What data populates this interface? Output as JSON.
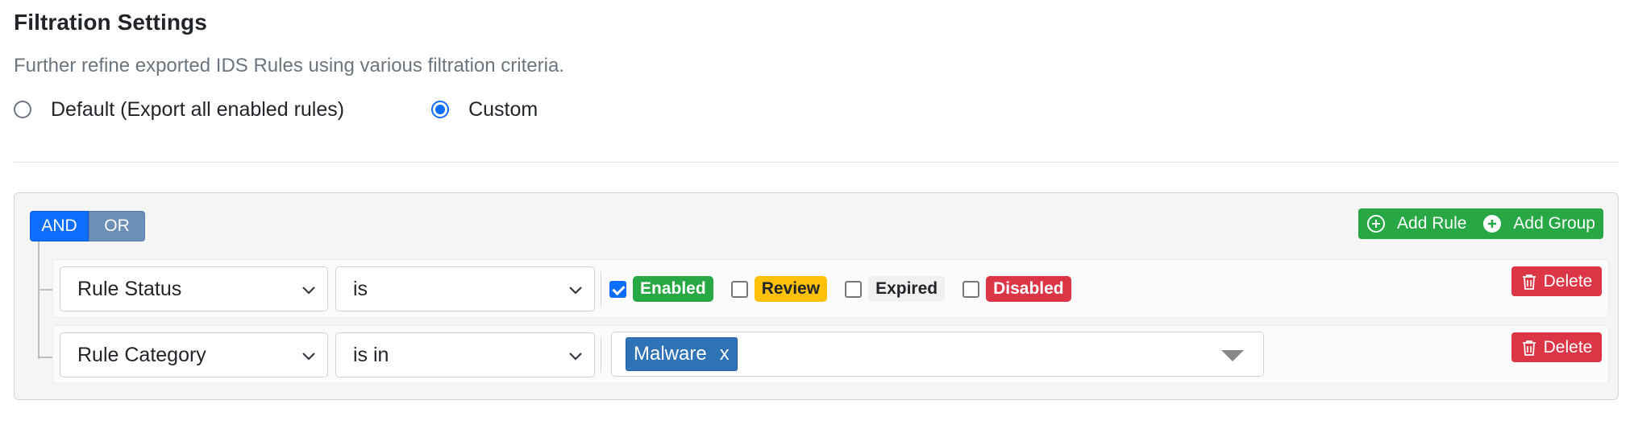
{
  "header": {
    "title": "Filtration Settings",
    "subtitle": "Further refine exported IDS Rules using various filtration criteria."
  },
  "mode": {
    "options": [
      {
        "label": "Default (Export all enabled rules)",
        "checked": false
      },
      {
        "label": "Custom",
        "checked": true
      }
    ]
  },
  "group": {
    "and_label": "AND",
    "or_label": "OR",
    "add_rule_label": "Add Rule",
    "add_group_label": "Add Group",
    "rules": [
      {
        "field": "Rule Status",
        "operator": "is",
        "checkboxes": [
          {
            "label": "Enabled",
            "checked": true,
            "color": "#28a745"
          },
          {
            "label": "Review",
            "checked": false,
            "color": "#ffc107"
          },
          {
            "label": "Expired",
            "checked": false,
            "color": "#f0f0f0"
          },
          {
            "label": "Disabled",
            "checked": false,
            "color": "#dc3545"
          }
        ],
        "delete_label": "Delete"
      },
      {
        "field": "Rule Category",
        "operator": "is in",
        "selected_tags": [
          {
            "label": "Malware",
            "remove": "x"
          }
        ],
        "delete_label": "Delete"
      }
    ]
  },
  "icons": {
    "add_rule": "plus-circle-outline-icon",
    "add_group": "plus-circle-filled-icon",
    "delete": "trash-icon",
    "dropdown": "chevron-down-icon"
  }
}
